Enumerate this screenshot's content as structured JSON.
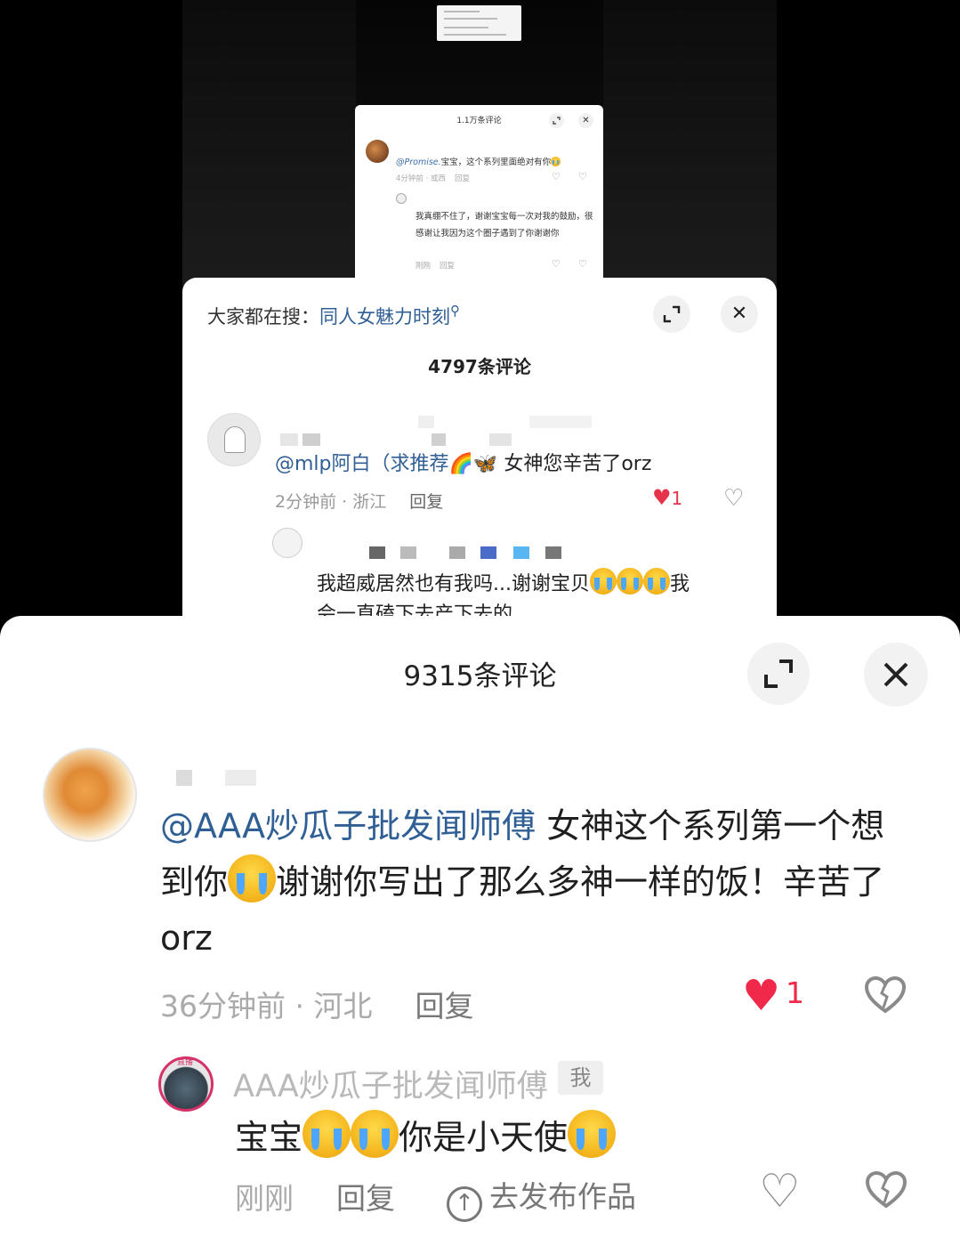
{
  "panel_small": {
    "title": "1.1万条评论",
    "comment1_mention": "@Promise.",
    "comment1_text": "宝宝，这个系列里面绝对有你",
    "comment1_time": "4分钟前 · 或西",
    "comment1_reply": "回复",
    "reply_text": "我真绷不住了，谢谢宝宝每一次对我的鼓励，很感谢让我因为这个圈子遇到了你谢谢你",
    "reply_time": "刚刚",
    "reply_reply": "回复"
  },
  "panel_medium": {
    "search_prefix": "大家都在搜：",
    "search_keyword": "同人女魅力时刻",
    "count": "4797条评论",
    "comment_mention": "@mlp阿白（求推荐",
    "comment_text": " 女神您辛苦了orz",
    "rainbow_emoji": "🌈",
    "butterfly_emoji": "🦋",
    "meta_time": "2分钟前 · 浙江",
    "meta_reply": "回复",
    "like_count": "1",
    "reply_text_a": "我超威居然也有我吗...谢谢宝贝",
    "reply_text_b": "我",
    "reply_text_line2": "会一直磕下去产下去的……"
  },
  "panel_large": {
    "count": "9315条评论",
    "comment_mention": "@AAA炒瓜子批发闻师傅",
    "comment_text_a": " 女神这个系列第一个想到你",
    "comment_text_b": "谢谢你写出了那么多神一样的饭！辛苦了orz",
    "meta_time": "36分钟前 · 河北",
    "meta_reply": "回复",
    "like_count": "1",
    "author_live_tag": "直播",
    "author_name": "AAA炒瓜子批发闻师傅",
    "author_tag": "我",
    "reply_text_a": "宝宝",
    "reply_text_b": "你是小天使",
    "reply_time": "刚刚",
    "reply_reply": "回复",
    "post_label": "去发布作品"
  }
}
